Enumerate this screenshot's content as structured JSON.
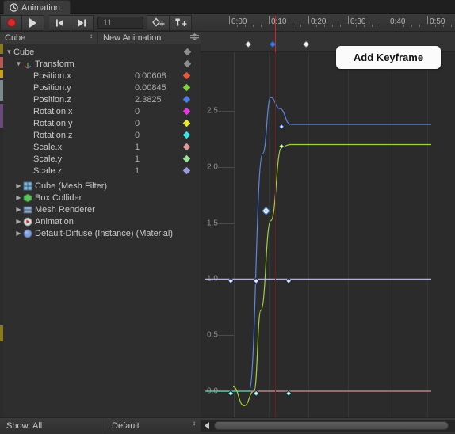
{
  "window": {
    "tab_label": "Animation",
    "tab_icon": "clock-icon"
  },
  "toolbar": {
    "record_label": "",
    "record_icon": "record-dot-icon",
    "play_icon": "play-icon",
    "prev_frame_icon": "prev-keyframe-icon",
    "next_frame_icon": "next-keyframe-icon",
    "frame_value": "11",
    "add_keyframe_icon": "add-keyframe-icon",
    "add_event_icon": "add-event-icon"
  },
  "selectors": {
    "object": "Cube",
    "clip": "New Animation",
    "dropdown_glyph": "↕"
  },
  "hierarchy": {
    "root": {
      "label": "Cube",
      "twirl": "▼",
      "diamond_color": "#8c8c8c"
    },
    "transform": {
      "label": "Transform",
      "twirl": "▼",
      "icon": "transform-axis-icon",
      "diamond_color": "#8c8c8c"
    },
    "properties": [
      {
        "label": "Position.x",
        "value": "0.00608",
        "color": "#e8563c"
      },
      {
        "label": "Position.y",
        "value": "0.00845",
        "color": "#7fd13b"
      },
      {
        "label": "Position.z",
        "value": "2.3825",
        "color": "#4a7fe0"
      },
      {
        "label": "Rotation.x",
        "value": "0",
        "color": "#e03ce0"
      },
      {
        "label": "Rotation.y",
        "value": "0",
        "color": "#e8e83c"
      },
      {
        "label": "Rotation.z",
        "value": "0",
        "color": "#3ce0e8"
      },
      {
        "label": "Scale.x",
        "value": "1",
        "color": "#e09a9a"
      },
      {
        "label": "Scale.y",
        "value": "1",
        "color": "#9ae09a"
      },
      {
        "label": "Scale.z",
        "value": "1",
        "color": "#9a9ae0"
      }
    ],
    "components": [
      {
        "label": "Cube (Mesh Filter)",
        "twirl": "▶",
        "icon": "mesh-filter-icon",
        "icon_color": "#7fb4d8"
      },
      {
        "label": "Box Collider",
        "twirl": "▶",
        "icon": "box-collider-icon",
        "icon_color": "#62c061"
      },
      {
        "label": "Mesh Renderer",
        "twirl": "▶",
        "icon": "mesh-renderer-icon",
        "icon_color": "#8fa9c8"
      },
      {
        "label": "Animation",
        "twirl": "▶",
        "icon": "animation-icon",
        "icon_color": "#d8d8d8"
      },
      {
        "label": "Default-Diffuse (Instance) (Material)",
        "twirl": "▶",
        "icon": "material-icon",
        "icon_color": "#7f9fd8"
      }
    ]
  },
  "timeline": {
    "tick_labels": [
      "0:00",
      "0:10",
      "0:20",
      "0:30",
      "0:40",
      "0:50"
    ],
    "tick_x": [
      36,
      86,
      136,
      186,
      236,
      286
    ],
    "playhead_x": 94,
    "playhead_color": "#e02020",
    "keyframes": [
      {
        "x": 63,
        "selected": false,
        "color": "#e8e8e8"
      },
      {
        "x": 94,
        "selected": true,
        "color": "#3b7fe0"
      },
      {
        "x": 136,
        "selected": false,
        "color": "#e8e8e8"
      }
    ]
  },
  "tooltip": {
    "label": "Add Keyframe"
  },
  "chart_data": {
    "type": "line",
    "title": "",
    "xlabel": "",
    "ylabel": "",
    "xlim": [
      -0.6,
      5.1
    ],
    "ylim": [
      -0.25,
      2.85
    ],
    "yticks": [
      0.0,
      0.5,
      1.0,
      1.5,
      2.0,
      2.5
    ],
    "ytick_labels": [
      "0.0",
      "0.5",
      "1.0",
      "1.5",
      "2.0",
      "2.5"
    ],
    "xticks": [
      0,
      1,
      2,
      3,
      4,
      5
    ],
    "grid": true,
    "series": [
      {
        "name": "Position.z",
        "color": "#5a86e0",
        "points": [
          [
            0.5,
            0.0
          ],
          [
            0.85,
            2.12
          ],
          [
            1.05,
            2.62
          ],
          [
            1.28,
            2.52
          ],
          [
            1.55,
            2.38
          ],
          [
            5.1,
            2.38
          ]
        ],
        "keyframes": [
          [
            1.38,
            2.38
          ]
        ]
      },
      {
        "name": "Position.y",
        "color": "#9fd13b",
        "points": [
          [
            0.1,
            0.04
          ],
          [
            0.38,
            -0.13
          ],
          [
            0.63,
            0.0
          ],
          [
            0.8,
            0.72
          ],
          [
            1.05,
            1.52
          ],
          [
            1.33,
            2.18
          ],
          [
            1.55,
            2.2
          ],
          [
            5.1,
            2.2
          ]
        ],
        "keyframes": [
          [
            1.38,
            2.2
          ]
        ]
      },
      {
        "name": "Scale (x,y,z)",
        "color": "#b0b0d8",
        "points": [
          [
            -0.6,
            1.0
          ],
          [
            5.1,
            1.0
          ]
        ],
        "keyframes": [
          [
            0.1,
            1.0
          ],
          [
            0.73,
            1.0
          ],
          [
            1.55,
            1.0
          ]
        ]
      },
      {
        "name": "Position.x",
        "color": "#6fd8b0",
        "points": [
          [
            -0.6,
            0.0
          ],
          [
            5.1,
            0.0
          ]
        ],
        "keyframes": [
          [
            0.1,
            0.0
          ],
          [
            0.73,
            0.0
          ],
          [
            1.55,
            0.0
          ]
        ]
      },
      {
        "name": "Rotation",
        "color": "#c87a8a",
        "points": [
          [
            0.55,
            0.0
          ],
          [
            5.1,
            0.0
          ]
        ],
        "keyframes": []
      }
    ]
  },
  "statusbar": {
    "show_label": "Show: All",
    "layout_label": "Default",
    "dropdown_glyph": "↕"
  }
}
